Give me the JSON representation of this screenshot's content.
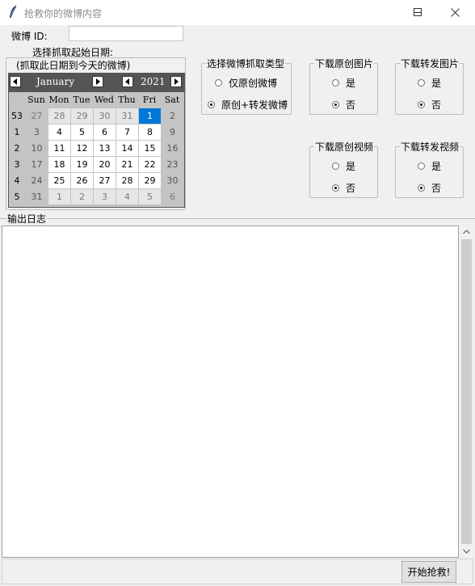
{
  "window": {
    "title": "抢救你的微博内容",
    "icon": "feather-icon",
    "min_icon": "minimize-icon",
    "max_icon": "maximize-icon",
    "close_icon": "close-icon"
  },
  "weibo_id": {
    "label": "微博 ID:",
    "value": "",
    "placeholder": ""
  },
  "date_picker": {
    "legend_line1": "选择抓取起始日期:",
    "legend_line2": "(抓取此日期到今天的微博)",
    "month": "January",
    "year": "2021",
    "weekdays": [
      "Sun",
      "Mon",
      "Tue",
      "Wed",
      "Thu",
      "Fri",
      "Sat"
    ],
    "weeks": [
      {
        "num": "53",
        "days": [
          {
            "d": "27",
            "other": true
          },
          {
            "d": "28",
            "other": true
          },
          {
            "d": "29",
            "other": true
          },
          {
            "d": "30",
            "other": true
          },
          {
            "d": "31",
            "other": true
          },
          {
            "d": "1",
            "other": false,
            "selected": true
          },
          {
            "d": "2",
            "other": false
          }
        ]
      },
      {
        "num": "1",
        "days": [
          {
            "d": "3",
            "other": false
          },
          {
            "d": "4",
            "other": false
          },
          {
            "d": "5",
            "other": false
          },
          {
            "d": "6",
            "other": false
          },
          {
            "d": "7",
            "other": false
          },
          {
            "d": "8",
            "other": false
          },
          {
            "d": "9",
            "other": false
          }
        ]
      },
      {
        "num": "2",
        "days": [
          {
            "d": "10",
            "other": false
          },
          {
            "d": "11",
            "other": false
          },
          {
            "d": "12",
            "other": false
          },
          {
            "d": "13",
            "other": false
          },
          {
            "d": "14",
            "other": false
          },
          {
            "d": "15",
            "other": false
          },
          {
            "d": "16",
            "other": false
          }
        ]
      },
      {
        "num": "3",
        "days": [
          {
            "d": "17",
            "other": false
          },
          {
            "d": "18",
            "other": false
          },
          {
            "d": "19",
            "other": false
          },
          {
            "d": "20",
            "other": false
          },
          {
            "d": "21",
            "other": false
          },
          {
            "d": "22",
            "other": false
          },
          {
            "d": "23",
            "other": false
          }
        ]
      },
      {
        "num": "4",
        "days": [
          {
            "d": "24",
            "other": false
          },
          {
            "d": "25",
            "other": false
          },
          {
            "d": "26",
            "other": false
          },
          {
            "d": "27",
            "other": false
          },
          {
            "d": "28",
            "other": false
          },
          {
            "d": "29",
            "other": false
          },
          {
            "d": "30",
            "other": false
          }
        ]
      },
      {
        "num": "5",
        "days": [
          {
            "d": "31",
            "other": false
          },
          {
            "d": "1",
            "other": true
          },
          {
            "d": "2",
            "other": true
          },
          {
            "d": "3",
            "other": true
          },
          {
            "d": "4",
            "other": true
          },
          {
            "d": "5",
            "other": true
          },
          {
            "d": "6",
            "other": true
          }
        ]
      }
    ],
    "selected_color": "#0078d7"
  },
  "crawl_type": {
    "legend": "选择微博抓取类型",
    "options": [
      {
        "label": "仅原创微博",
        "checked": false
      },
      {
        "label": "原创+转发微博",
        "checked": true
      }
    ]
  },
  "download_original_images": {
    "legend": "下载原创图片",
    "yes": "是",
    "no": "否",
    "selected": "no"
  },
  "download_repost_images": {
    "legend": "下载转发图片",
    "yes": "是",
    "no": "否",
    "selected": "no"
  },
  "download_original_videos": {
    "legend": "下载原创视频",
    "yes": "是",
    "no": "否",
    "selected": "no"
  },
  "download_repost_videos": {
    "legend": "下载转发视频",
    "yes": "是",
    "no": "否",
    "selected": "no"
  },
  "log": {
    "legend": "输出日志",
    "content": ""
  },
  "start_button": {
    "label": "开始抢救!"
  }
}
